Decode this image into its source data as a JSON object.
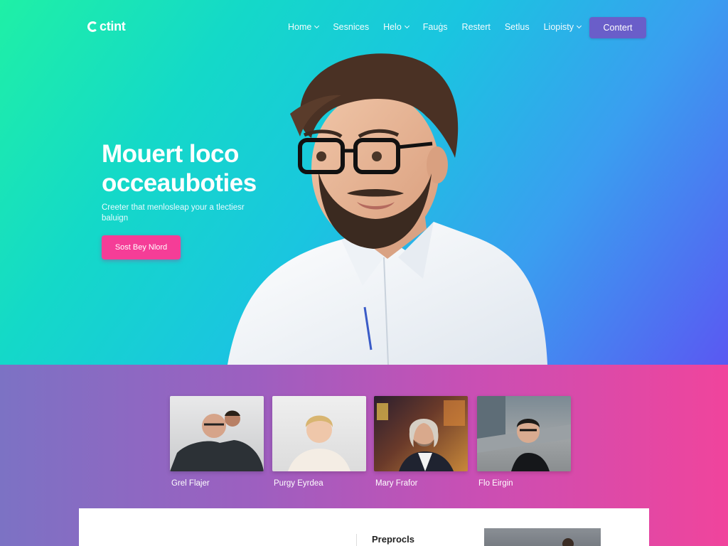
{
  "brand": {
    "logo_text": "ctint"
  },
  "nav": {
    "items": [
      {
        "label": "Home",
        "dropdown": true
      },
      {
        "label": "Sesnices",
        "dropdown": false
      },
      {
        "label": "Helo",
        "dropdown": true
      },
      {
        "label": "Fauġs",
        "dropdown": false
      },
      {
        "label": "Restert",
        "dropdown": false
      },
      {
        "label": "Setlus",
        "dropdown": false
      },
      {
        "label": "Liopisty",
        "dropdown": true
      }
    ],
    "cta_label": "Contert"
  },
  "hero": {
    "headline_line1": "Mouert loco",
    "headline_line2": "occeauboties",
    "subtext": "Creeter that menlosleap your a tlectiesr baluign",
    "cta_label": "Sost Bey Nlord"
  },
  "team": {
    "members": [
      {
        "name": "Grel Flajer"
      },
      {
        "name": "Purgy Eyrdea"
      },
      {
        "name": "Mary Frafor"
      },
      {
        "name": "Flo Eirgin"
      }
    ]
  },
  "panel": {
    "title": "Preprocls"
  },
  "colors": {
    "contact_button": "#6a5ec9",
    "start_button": "#f53d97",
    "hero_gradient_start": "#1ff0a6",
    "hero_gradient_end": "#5a58f2",
    "team_gradient_start": "#7c72c4",
    "team_gradient_end": "#f0449c"
  }
}
